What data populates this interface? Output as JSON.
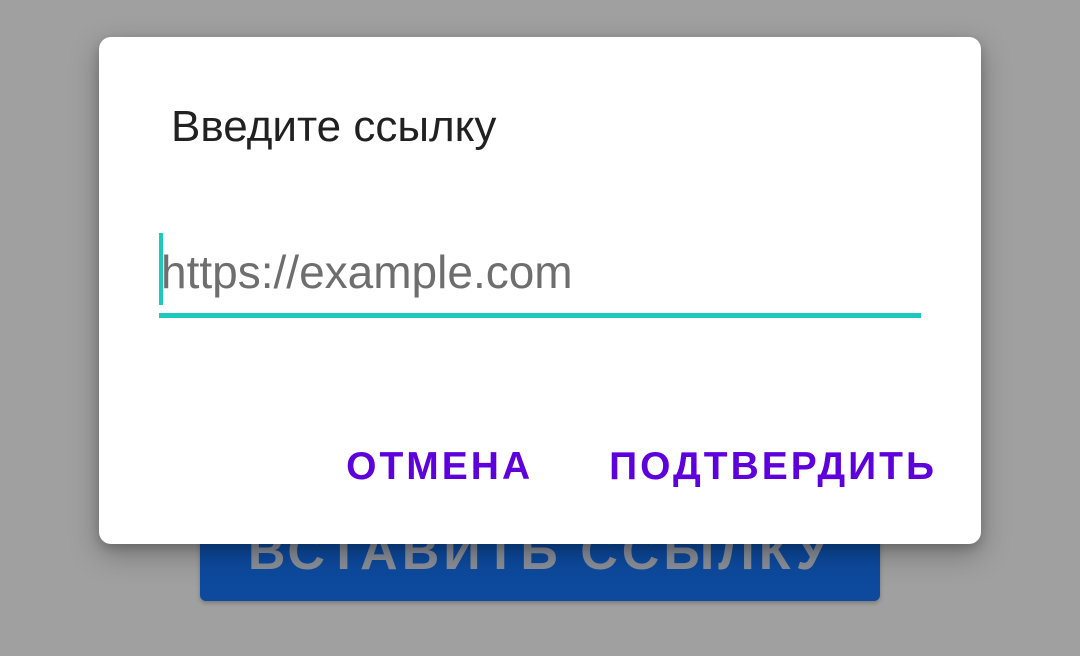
{
  "background": {
    "button_label": "ВСТАВИТЬ ССЫЛКУ"
  },
  "dialog": {
    "title": "Введите ссылку",
    "input": {
      "value": "",
      "placeholder": "https://example.com"
    },
    "actions": {
      "cancel_label": "ОТМЕНА",
      "confirm_label": "ПОДТВЕРДИТЬ"
    }
  },
  "colors": {
    "accent": "#1cc9bd",
    "action_text": "#5e00dc",
    "background_button": "#0d4a9e",
    "scrim": "#a0a0a0"
  }
}
